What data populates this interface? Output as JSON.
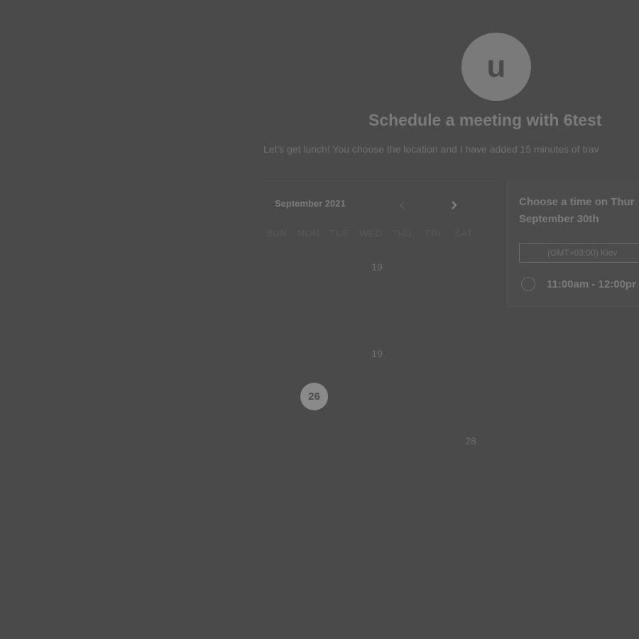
{
  "header": {
    "avatar_letter": "u",
    "title": "Schedule a meeting with 6test",
    "description": "Let's get lunch! You choose the location and I have added 15 minutes of trav"
  },
  "calendar": {
    "month_label": "September 2021",
    "weekdays": [
      "SUN",
      "MON",
      "TUE",
      "WED",
      "THU",
      "FRI",
      "SAT"
    ],
    "visible_days": [
      "19",
      "19",
      "26",
      "28"
    ],
    "selected_day": "26"
  },
  "times": {
    "heading_line1": "Choose a time on Thur",
    "heading_line2": "September 30th",
    "timezone": "(GMT+03:00) Kiev",
    "slot_label": "11:00am - 12:00pr"
  },
  "colors": {
    "overlay_background": "#4a4a4a",
    "selected_day_fill": "#8a8a8a"
  },
  "icons": {
    "prev": "chevron-left-icon",
    "next": "chevron-right-icon",
    "slot": "radio-icon"
  }
}
